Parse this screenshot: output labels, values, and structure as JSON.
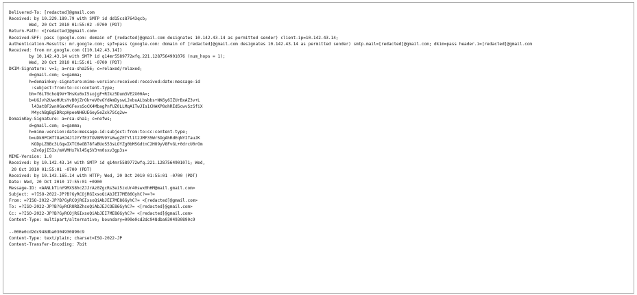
{
  "header_lines": [
    "Delivered-To: [redacted]@gmail.com",
    "Received: by 10.229.189.79 with SMTP id dd15cs87643qcb;",
    "        Wed, 20 Oct 2010 01:55:02 -0700 (PDT)",
    "Return-Path: <[redacted]@gmail.com>",
    "Received-SPF: pass (google.com: domain of [redacted]@gmail.com designates 10.142.43.14 as permitted sender) client-ip=10.142.43.14;",
    "Authentication-Results: mr.google.com; spf=pass (google.com: domain of [redacted]@gmail.com designates 10.142.43.14 as permitted sender) smtp.mail=[redacted]@gmail.com; dkim=pass header.i=[redacted]@gmail.com",
    "Received: from mr.google.com ([10.142.43.14])",
    "        by 10.142.43.14 with SMTP id q14mr5589772wfq.221.1287564901076 (num_hops = 1);",
    "        Wed, 20 Oct 2010 01:55:01 -0700 (PDT)",
    "DKIM-Signature: v=1; a=rsa-sha256; c=relaxed/relaxed;",
    "        d=gmail.com; s=gamma;",
    "        h=domainkey-signature:mime-version:received:received:date:message-id",
    "         :subject:from:to:cc:content-type;",
    "        bh=f6LT0choQ9V+THsKu0xI5sojgF+RIkz5Dum3VE2X00A=;",
    "        b=UGJvh2UwoHUtsYvB0jZrOk+eV0vGYdAmDyswLJxbuALbsbbs+NK6y6IZUrBxAZ3v+L",
    "         l43at8F2wn0GaxMGFevsSoCK4MbagPnfUZ0LLMqA1TwJIs1CHAKP8ohREdScwvSzSfiX",
    "         M4ychBgBg5DRcpHpeeNH6UEGey5eZxk7SCq2w=",
    "DomainKey-Signature: a=rsa-sha1; c=nofws;",
    "        d=gmail.com; s=gamma;",
    "        h=mime-version:date:message-id:subject:from:to:cc:content-type;",
    "        b=uDk0PCWf7UaHJ4JtJYYfE3TOV8MV9Ys6wgZETYl1t2JMF35Wr5DgAhRdEqNYIfauJK",
    "         KGDpLZ8Bc3LGqwIXTC6eGB78faBUoS53sLOYZg0bMSGdtnC2HU9yV8FvGL+0drcU0rOm",
    "         oZv6pjI5Ix/mXVMHx7kl45qSV3+m0sxv3gp3s=",
    "MIME-Version: 1.0",
    "Received: by 10.142.43.14 with SMTP id q14mr5589772wfq.221.1287564901071; Wed,",
    " 20 Oct 2010 01:55:01 -0700 (PDT)",
    "Received: by 10.143.165.14 with HTTP; Wed, 20 Oct 2010 01:55:01 -0700 (PDT)",
    "Date: Wed, 20 Oct 2010 17:55:01 +0900",
    "Message-ID: <AANLkTinY9MXS8hcZJJrAz0ZgcRs3ei5zxUr40swx0hHM@mail.gmail.com>",
    "Subject: =?ISO-2022-JP?B?GyRCOjRGIxsoQiAbJEI7ME86GyhC?==?=",
    "From: =?ISO-2022-JP?B?GyRCOjRGIxsoQiAbJEI7ME86GyhC?= <[redacted]@gmail.com>",
    "To: =?ISO-2022-JP?B?GyRCRURDZhsoQiAbJEJCOE86GyhC?= <[redacted]@gmail.com>",
    "Cc: =?ISO-2022-JP?B?GyRCOjRGIxsoQiAbJEI7ME86GyhC?= <[redacted]@gmail.com>",
    "Content-Type: multipart/alternative; boundary=000e0cd2dc948dba0304930890c9",
    "",
    "--000e0cd2dc948dba0304930890c9",
    "Content-Type: text/plain; charset=ISO-2022-JP",
    "Content-Transfer-Encoding: 7bit"
  ]
}
